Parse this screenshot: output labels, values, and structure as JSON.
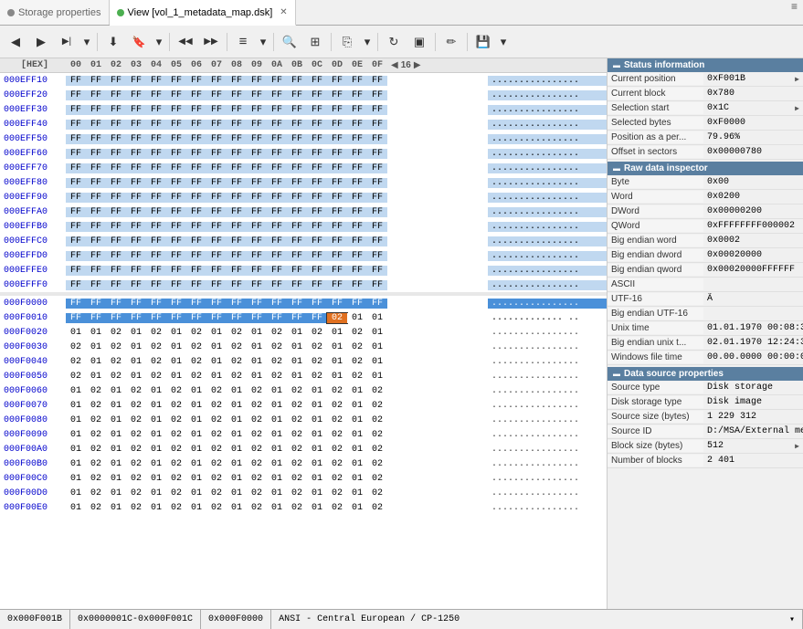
{
  "tabs": [
    {
      "id": "storage",
      "label": "Storage properties",
      "active": false,
      "dot": "gray"
    },
    {
      "id": "view",
      "label": "View [vol_1_metadata_map.dsk]",
      "active": true,
      "dot": "green",
      "closable": true
    }
  ],
  "toolbar": {
    "buttons": [
      {
        "name": "back",
        "icon": "◀",
        "title": "Back"
      },
      {
        "name": "forward",
        "icon": "▶",
        "title": "Forward"
      },
      {
        "name": "forward2",
        "icon": "▶|",
        "title": "Forward2"
      },
      {
        "name": "dropdown1",
        "icon": "▾",
        "title": ""
      },
      {
        "name": "download",
        "icon": "⬇",
        "title": "Download"
      },
      {
        "name": "bookmark",
        "icon": "🔖",
        "title": "Bookmark"
      },
      {
        "name": "dropdown2",
        "icon": "▾",
        "title": ""
      },
      {
        "name": "prev",
        "icon": "◀◀",
        "title": "Previous"
      },
      {
        "name": "next",
        "icon": "▶▶",
        "title": "Next"
      },
      {
        "name": "list",
        "icon": "≡",
        "title": "List"
      },
      {
        "name": "dropdown3",
        "icon": "▾",
        "title": ""
      },
      {
        "name": "search",
        "icon": "🔍",
        "title": "Search"
      },
      {
        "name": "grid",
        "icon": "⊞",
        "title": "Grid"
      },
      {
        "name": "copy",
        "icon": "⎘",
        "title": "Copy"
      },
      {
        "name": "dropdown4",
        "icon": "▾",
        "title": ""
      },
      {
        "name": "refresh",
        "icon": "↻",
        "title": "Refresh"
      },
      {
        "name": "toggle",
        "icon": "▣",
        "title": "Toggle"
      },
      {
        "name": "edit",
        "icon": "✏",
        "title": "Edit"
      },
      {
        "name": "save",
        "icon": "💾",
        "title": "Save"
      },
      {
        "name": "dropdown5",
        "icon": "▾",
        "title": ""
      }
    ]
  },
  "hex_header": {
    "label": "[HEX]",
    "cols": [
      "00",
      "01",
      "02",
      "03",
      "04",
      "05",
      "06",
      "07",
      "08",
      "09",
      "0A",
      "0B",
      "0C",
      "0D",
      "0E",
      "0F"
    ],
    "nav_prev": "◀",
    "nav_count": "16",
    "nav_next": "▶"
  },
  "hex_rows_group1": [
    {
      "addr": "000EFF10",
      "bytes": [
        "FF",
        "FF",
        "FF",
        "FF",
        "FF",
        "FF",
        "FF",
        "FF",
        "FF",
        "FF",
        "FF",
        "FF",
        "FF",
        "FF",
        "FF",
        "FF"
      ],
      "ascii": "................"
    },
    {
      "addr": "000EFF20",
      "bytes": [
        "FF",
        "FF",
        "FF",
        "FF",
        "FF",
        "FF",
        "FF",
        "FF",
        "FF",
        "FF",
        "FF",
        "FF",
        "FF",
        "FF",
        "FF",
        "FF"
      ],
      "ascii": "................"
    },
    {
      "addr": "000EFF30",
      "bytes": [
        "FF",
        "FF",
        "FF",
        "FF",
        "FF",
        "FF",
        "FF",
        "FF",
        "FF",
        "FF",
        "FF",
        "FF",
        "FF",
        "FF",
        "FF",
        "FF"
      ],
      "ascii": "................"
    },
    {
      "addr": "000EFF40",
      "bytes": [
        "FF",
        "FF",
        "FF",
        "FF",
        "FF",
        "FF",
        "FF",
        "FF",
        "FF",
        "FF",
        "FF",
        "FF",
        "FF",
        "FF",
        "FF",
        "FF"
      ],
      "ascii": "................"
    },
    {
      "addr": "000EFF50",
      "bytes": [
        "FF",
        "FF",
        "FF",
        "FF",
        "FF",
        "FF",
        "FF",
        "FF",
        "FF",
        "FF",
        "FF",
        "FF",
        "FF",
        "FF",
        "FF",
        "FF"
      ],
      "ascii": "................"
    },
    {
      "addr": "000EFF60",
      "bytes": [
        "FF",
        "FF",
        "FF",
        "FF",
        "FF",
        "FF",
        "FF",
        "FF",
        "FF",
        "FF",
        "FF",
        "FF",
        "FF",
        "FF",
        "FF",
        "FF"
      ],
      "ascii": "................"
    },
    {
      "addr": "000EFF70",
      "bytes": [
        "FF",
        "FF",
        "FF",
        "FF",
        "FF",
        "FF",
        "FF",
        "FF",
        "FF",
        "FF",
        "FF",
        "FF",
        "FF",
        "FF",
        "FF",
        "FF"
      ],
      "ascii": "................"
    },
    {
      "addr": "000EFF80",
      "bytes": [
        "FF",
        "FF",
        "FF",
        "FF",
        "FF",
        "FF",
        "FF",
        "FF",
        "FF",
        "FF",
        "FF",
        "FF",
        "FF",
        "FF",
        "FF",
        "FF"
      ],
      "ascii": "................"
    },
    {
      "addr": "000EFF90",
      "bytes": [
        "FF",
        "FF",
        "FF",
        "FF",
        "FF",
        "FF",
        "FF",
        "FF",
        "FF",
        "FF",
        "FF",
        "FF",
        "FF",
        "FF",
        "FF",
        "FF"
      ],
      "ascii": "................"
    },
    {
      "addr": "000EFFA0",
      "bytes": [
        "FF",
        "FF",
        "FF",
        "FF",
        "FF",
        "FF",
        "FF",
        "FF",
        "FF",
        "FF",
        "FF",
        "FF",
        "FF",
        "FF",
        "FF",
        "FF"
      ],
      "ascii": "................"
    },
    {
      "addr": "000EFFB0",
      "bytes": [
        "FF",
        "FF",
        "FF",
        "FF",
        "FF",
        "FF",
        "FF",
        "FF",
        "FF",
        "FF",
        "FF",
        "FF",
        "FF",
        "FF",
        "FF",
        "FF"
      ],
      "ascii": "................"
    },
    {
      "addr": "000EFFC0",
      "bytes": [
        "FF",
        "FF",
        "FF",
        "FF",
        "FF",
        "FF",
        "FF",
        "FF",
        "FF",
        "FF",
        "FF",
        "FF",
        "FF",
        "FF",
        "FF",
        "FF"
      ],
      "ascii": "................"
    },
    {
      "addr": "000EFFD0",
      "bytes": [
        "FF",
        "FF",
        "FF",
        "FF",
        "FF",
        "FF",
        "FF",
        "FF",
        "FF",
        "FF",
        "FF",
        "FF",
        "FF",
        "FF",
        "FF",
        "FF"
      ],
      "ascii": "................"
    },
    {
      "addr": "000EFFE0",
      "bytes": [
        "FF",
        "FF",
        "FF",
        "FF",
        "FF",
        "FF",
        "FF",
        "FF",
        "FF",
        "FF",
        "FF",
        "FF",
        "FF",
        "FF",
        "FF",
        "FF"
      ],
      "ascii": "................"
    },
    {
      "addr": "000EFFF0",
      "bytes": [
        "FF",
        "FF",
        "FF",
        "FF",
        "FF",
        "FF",
        "FF",
        "FF",
        "FF",
        "FF",
        "FF",
        "FF",
        "FF",
        "FF",
        "FF",
        "FF"
      ],
      "ascii": "................"
    }
  ],
  "hex_rows_transition": [
    {
      "addr": "000F0000",
      "bytes": [
        "FF",
        "FF",
        "FF",
        "FF",
        "FF",
        "FF",
        "FF",
        "FF",
        "FF",
        "FF",
        "FF",
        "FF",
        "FF",
        "FF",
        "FF",
        "FF"
      ],
      "ascii": "................",
      "selected": true
    },
    {
      "addr": "000F0010",
      "bytes": [
        "FF",
        "FF",
        "FF",
        "FF",
        "FF",
        "FF",
        "FF",
        "FF",
        "FF",
        "FF",
        "FF",
        "FF",
        "FF",
        "02",
        "01",
        "01"
      ],
      "ascii": "............. ..",
      "selected_partial": 13,
      "current_byte": 13
    }
  ],
  "hex_rows_group2": [
    {
      "addr": "000F0020",
      "bytes": [
        "01",
        "01",
        "02",
        "01",
        "02",
        "01",
        "02",
        "01",
        "02",
        "01",
        "02",
        "01",
        "02",
        "01",
        "02",
        "01"
      ],
      "ascii": "................"
    },
    {
      "addr": "000F0030",
      "bytes": [
        "02",
        "01",
        "02",
        "01",
        "02",
        "01",
        "02",
        "01",
        "02",
        "01",
        "02",
        "01",
        "02",
        "01",
        "02",
        "01"
      ],
      "ascii": "................"
    },
    {
      "addr": "000F0040",
      "bytes": [
        "02",
        "01",
        "02",
        "01",
        "02",
        "01",
        "02",
        "01",
        "02",
        "01",
        "02",
        "01",
        "02",
        "01",
        "02",
        "01"
      ],
      "ascii": "................"
    },
    {
      "addr": "000F0050",
      "bytes": [
        "02",
        "01",
        "02",
        "01",
        "02",
        "01",
        "02",
        "01",
        "02",
        "01",
        "02",
        "01",
        "02",
        "01",
        "02",
        "01"
      ],
      "ascii": "................"
    },
    {
      "addr": "000F0060",
      "bytes": [
        "01",
        "02",
        "01",
        "02",
        "01",
        "02",
        "01",
        "02",
        "01",
        "02",
        "01",
        "02",
        "01",
        "02",
        "01",
        "02"
      ],
      "ascii": "................"
    },
    {
      "addr": "000F0070",
      "bytes": [
        "01",
        "02",
        "01",
        "02",
        "01",
        "02",
        "01",
        "02",
        "01",
        "02",
        "01",
        "02",
        "01",
        "02",
        "01",
        "02"
      ],
      "ascii": "................"
    },
    {
      "addr": "000F0080",
      "bytes": [
        "01",
        "02",
        "01",
        "02",
        "01",
        "02",
        "01",
        "02",
        "01",
        "02",
        "01",
        "02",
        "01",
        "02",
        "01",
        "02"
      ],
      "ascii": "................"
    },
    {
      "addr": "000F0090",
      "bytes": [
        "01",
        "02",
        "01",
        "02",
        "01",
        "02",
        "01",
        "02",
        "01",
        "02",
        "01",
        "02",
        "01",
        "02",
        "01",
        "02"
      ],
      "ascii": "................"
    },
    {
      "addr": "000F00A0",
      "bytes": [
        "01",
        "02",
        "01",
        "02",
        "01",
        "02",
        "01",
        "02",
        "01",
        "02",
        "01",
        "02",
        "01",
        "02",
        "01",
        "02"
      ],
      "ascii": "................"
    },
    {
      "addr": "000F00B0",
      "bytes": [
        "01",
        "02",
        "01",
        "02",
        "01",
        "02",
        "01",
        "02",
        "01",
        "02",
        "01",
        "02",
        "01",
        "02",
        "01",
        "02"
      ],
      "ascii": "................"
    },
    {
      "addr": "000F00C0",
      "bytes": [
        "01",
        "02",
        "01",
        "02",
        "01",
        "02",
        "01",
        "02",
        "01",
        "02",
        "01",
        "02",
        "01",
        "02",
        "01",
        "02"
      ],
      "ascii": "................"
    },
    {
      "addr": "000F00D0",
      "bytes": [
        "01",
        "02",
        "01",
        "02",
        "01",
        "02",
        "01",
        "02",
        "01",
        "02",
        "01",
        "02",
        "01",
        "02",
        "01",
        "02"
      ],
      "ascii": "................"
    },
    {
      "addr": "000F00E0",
      "bytes": [
        "01",
        "02",
        "01",
        "02",
        "01",
        "02",
        "01",
        "02",
        "01",
        "02",
        "01",
        "02",
        "01",
        "02",
        "01",
        "02"
      ],
      "ascii": "................"
    }
  ],
  "right_panel": {
    "status_section": "Status information",
    "status_rows": [
      {
        "label": "Current position",
        "value": "0xF001B",
        "has_arrow": true
      },
      {
        "label": "Current block",
        "value": "0x780",
        "has_arrow": false
      },
      {
        "label": "Selection start",
        "value": "0x1C",
        "has_arrow": true
      },
      {
        "label": "Selected bytes",
        "value": "0xF0000",
        "has_arrow": false
      },
      {
        "label": "Position as a per...",
        "value": "79.96%",
        "has_arrow": false
      },
      {
        "label": "Offset in sectors",
        "value": "0x00000780",
        "has_arrow": false
      }
    ],
    "raw_section": "Raw data inspector",
    "raw_rows": [
      {
        "label": "Byte",
        "value": "0x00"
      },
      {
        "label": "Word",
        "value": "0x0200"
      },
      {
        "label": "DWord",
        "value": "0x00000200"
      },
      {
        "label": "QWord",
        "value": "0xFFFFFFFF000002"
      },
      {
        "label": "Big endian word",
        "value": "0x0002"
      },
      {
        "label": "Big endian dword",
        "value": "0x00020000"
      },
      {
        "label": "Big endian qword",
        "value": "0x00020000FFFFFF"
      },
      {
        "label": "ASCII",
        "value": ""
      },
      {
        "label": "UTF-16",
        "value": "Ã"
      },
      {
        "label": "Big endian UTF-16",
        "value": ""
      },
      {
        "label": "Unix time",
        "value": "01.01.1970 00:08:3"
      },
      {
        "label": "Big endian unix t...",
        "value": "02.01.1970 12:24:3"
      },
      {
        "label": "Windows file time",
        "value": "00.00.0000 00:00:0"
      }
    ],
    "datasource_section": "Data source properties",
    "datasource_rows": [
      {
        "label": "Source type",
        "value": "Disk storage"
      },
      {
        "label": "Disk storage type",
        "value": "Disk image"
      },
      {
        "label": "Source size (bytes)",
        "value": "1 229 312"
      },
      {
        "label": "Source ID",
        "value": "D:/MSA/External me"
      },
      {
        "label": "Block size (bytes)",
        "value": "512",
        "has_arrow": true
      },
      {
        "label": "Number of blocks",
        "value": "2 401"
      }
    ]
  },
  "status_bar": {
    "position": "0x000F001B",
    "selection": "0x0000001C-0x000F001C",
    "block": "0x000F0000",
    "encoding": "ANSI - Central European / CP-1250",
    "dropdown_arrow": "▾"
  }
}
